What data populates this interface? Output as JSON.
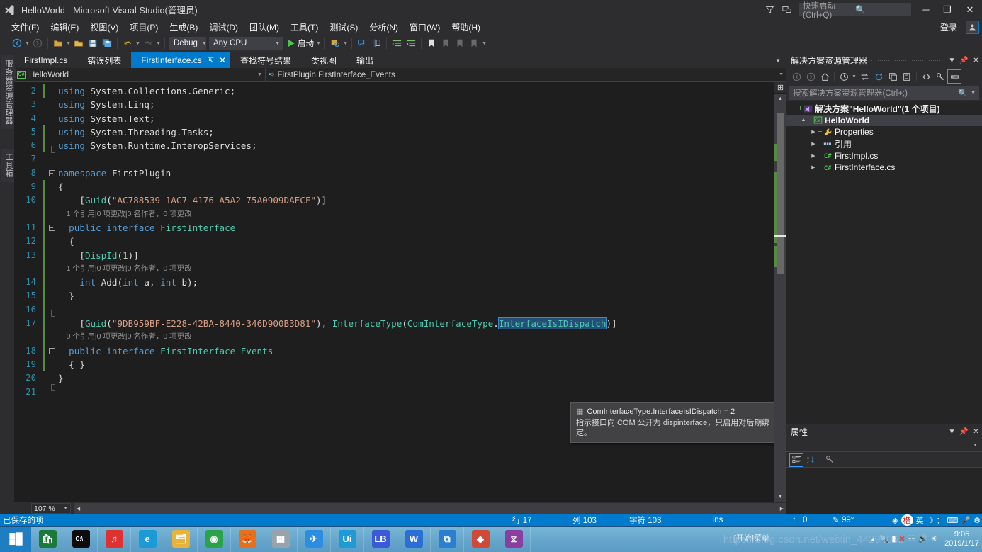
{
  "titlebar": {
    "app_title": "HelloWorld - Microsoft Visual Studio(管理员)",
    "quick_launch_placeholder": "快速启动 (Ctrl+Q)",
    "icons": {
      "feedback": "funnel-icon",
      "layout": "window-layout-icon",
      "search": "search-icon"
    },
    "minimize": "─",
    "restore": "❐",
    "close": "✕"
  },
  "menubar": {
    "items": [
      {
        "label": "文件(F)"
      },
      {
        "label": "编辑(E)"
      },
      {
        "label": "视图(V)"
      },
      {
        "label": "项目(P)"
      },
      {
        "label": "生成(B)"
      },
      {
        "label": "调试(D)"
      },
      {
        "label": "团队(M)"
      },
      {
        "label": "工具(T)"
      },
      {
        "label": "测试(S)"
      },
      {
        "label": "分析(N)"
      },
      {
        "label": "窗口(W)"
      },
      {
        "label": "帮助(H)"
      }
    ],
    "signin_label": "登录"
  },
  "toolbar": {
    "config": "Debug",
    "platform": "Any CPU",
    "run_label": "启动"
  },
  "tabs": {
    "items": [
      {
        "label": "FirstImpl.cs",
        "active": false
      },
      {
        "label": "错误列表",
        "active": false
      },
      {
        "label": "FirstInterface.cs",
        "active": true
      },
      {
        "label": "查找符号结果",
        "active": false
      },
      {
        "label": "类视图",
        "active": false
      },
      {
        "label": "输出",
        "active": false
      }
    ],
    "pin_glyph": "⇱",
    "close_glyph": "✕"
  },
  "navbar": {
    "project": "HelloWorld",
    "member": "FirstPlugin.FirstInterface_Events"
  },
  "editor": {
    "zoom": "107 %",
    "lines": [
      {
        "num": "2",
        "codelens": null,
        "change": true,
        "fold": null,
        "guide": "none",
        "tokens": [
          {
            "t": "using ",
            "c": "k-blue"
          },
          {
            "t": "System.Collections.Generic;",
            "c": "k-plain"
          }
        ],
        "indent": 0
      },
      {
        "num": "3",
        "codelens": null,
        "change": false,
        "fold": null,
        "guide": "line",
        "tokens": [
          {
            "t": "using ",
            "c": "k-blue"
          },
          {
            "t": "System.Linq;",
            "c": "k-plain"
          }
        ],
        "indent": 0
      },
      {
        "num": "4",
        "codelens": null,
        "change": false,
        "fold": null,
        "guide": "line",
        "tokens": [
          {
            "t": "using ",
            "c": "k-blue"
          },
          {
            "t": "System.Text;",
            "c": "k-plain"
          }
        ],
        "indent": 0
      },
      {
        "num": "5",
        "codelens": null,
        "change": true,
        "fold": null,
        "guide": "line",
        "tokens": [
          {
            "t": "using ",
            "c": "k-blue"
          },
          {
            "t": "System.Threading.Tasks;",
            "c": "k-plain"
          }
        ],
        "indent": 0
      },
      {
        "num": "6",
        "codelens": null,
        "change": true,
        "fold": null,
        "guide": "endline",
        "tokens": [
          {
            "t": "using ",
            "c": "k-blue"
          },
          {
            "t": "System.Runtime.InteropServices;",
            "c": "k-plain"
          }
        ],
        "indent": 0
      },
      {
        "num": "7",
        "codelens": null,
        "change": false,
        "fold": null,
        "guide": "none",
        "tokens": [],
        "indent": 0
      },
      {
        "num": "8",
        "codelens": null,
        "change": false,
        "fold": "minus",
        "guide": "none",
        "tokens": [
          {
            "t": "namespace ",
            "c": "k-blue"
          },
          {
            "t": "FirstPlugin",
            "c": "k-plain"
          }
        ],
        "indent": 0
      },
      {
        "num": "9",
        "codelens": null,
        "change": true,
        "fold": null,
        "guide": "line",
        "tokens": [
          {
            "t": "{",
            "c": "k-plain"
          }
        ],
        "indent": 0
      },
      {
        "num": "10",
        "codelens": "1 个引用|0 项更改|0 名作者，0 项更改",
        "change": true,
        "fold": null,
        "guide": "line",
        "tokens": [
          {
            "t": "[",
            "c": "k-plain"
          },
          {
            "t": "Guid",
            "c": "k-type"
          },
          {
            "t": "(",
            "c": "k-plain"
          },
          {
            "t": "\"AC788539-1AC7-4176-A5A2-75A0909DAECF\"",
            "c": "k-str"
          },
          {
            "t": ")]",
            "c": "k-plain"
          }
        ],
        "indent": 2
      },
      {
        "num": "11",
        "codelens": null,
        "change": true,
        "fold": "minus",
        "guide": "line",
        "tokens": [
          {
            "t": "public ",
            "c": "k-blue"
          },
          {
            "t": "interface ",
            "c": "k-blue"
          },
          {
            "t": "FirstInterface",
            "c": "k-type"
          }
        ],
        "indent": 1
      },
      {
        "num": "12",
        "codelens": null,
        "change": true,
        "fold": null,
        "guide": "line",
        "tokens": [
          {
            "t": "{",
            "c": "k-plain"
          }
        ],
        "indent": 1
      },
      {
        "num": "13",
        "codelens": "1 个引用|0 项更改|0 名作者，0 项更改",
        "change": true,
        "fold": null,
        "guide": "line",
        "tokens": [
          {
            "t": "[",
            "c": "k-plain"
          },
          {
            "t": "DispId",
            "c": "k-type"
          },
          {
            "t": "(",
            "c": "k-plain"
          },
          {
            "t": "1",
            "c": "k-num"
          },
          {
            "t": ")]",
            "c": "k-plain"
          }
        ],
        "indent": 2
      },
      {
        "num": "14",
        "codelens": null,
        "change": true,
        "fold": null,
        "guide": "line",
        "tokens": [
          {
            "t": "int ",
            "c": "k-blue"
          },
          {
            "t": "Add",
            "c": "k-plain"
          },
          {
            "t": "(",
            "c": "k-plain"
          },
          {
            "t": "int ",
            "c": "k-blue"
          },
          {
            "t": "a, ",
            "c": "k-plain"
          },
          {
            "t": "int ",
            "c": "k-blue"
          },
          {
            "t": "b);",
            "c": "k-plain"
          }
        ],
        "indent": 2
      },
      {
        "num": "15",
        "codelens": null,
        "change": true,
        "fold": null,
        "guide": "line",
        "tokens": [
          {
            "t": "}",
            "c": "k-plain"
          }
        ],
        "indent": 1
      },
      {
        "num": "16",
        "codelens": null,
        "change": true,
        "fold": null,
        "guide": "endline",
        "tokens": [],
        "indent": 0
      },
      {
        "num": "17",
        "codelens": "0 个引用|0 项更改|0 名作者，0 项更改",
        "change": true,
        "fold": null,
        "guide": "line",
        "tokens": [
          {
            "t": "[",
            "c": "k-plain"
          },
          {
            "t": "Guid",
            "c": "k-type"
          },
          {
            "t": "(",
            "c": "k-plain"
          },
          {
            "t": "\"9DB959BF-E228-42BA-8440-346D900B3D81\"",
            "c": "k-str"
          },
          {
            "t": "), ",
            "c": "k-plain"
          },
          {
            "t": "InterfaceType",
            "c": "k-type"
          },
          {
            "t": "(",
            "c": "k-plain"
          },
          {
            "t": "ComInterfaceType",
            "c": "k-type"
          },
          {
            "t": ".",
            "c": "k-plain"
          },
          {
            "t": "InterfaceIsIDispatch",
            "c": "sel k-type"
          },
          {
            "t": ")]",
            "c": "k-plain"
          }
        ],
        "indent": 2
      },
      {
        "num": "18",
        "codelens": null,
        "change": true,
        "fold": "minus",
        "guide": "line",
        "tokens": [
          {
            "t": "public ",
            "c": "k-blue"
          },
          {
            "t": "interface ",
            "c": "k-blue"
          },
          {
            "t": "FirstInterface_Events",
            "c": "k-type"
          }
        ],
        "indent": 1
      },
      {
        "num": "19",
        "codelens": null,
        "change": true,
        "fold": null,
        "guide": "line",
        "tokens": [
          {
            "t": "{ }",
            "c": "k-plain"
          }
        ],
        "indent": 1
      },
      {
        "num": "20",
        "codelens": null,
        "change": false,
        "fold": null,
        "guide": "endtop",
        "tokens": [
          {
            "t": "}",
            "c": "k-plain"
          }
        ],
        "indent": 0
      },
      {
        "num": "21",
        "codelens": null,
        "change": false,
        "fold": null,
        "guide": "none",
        "tokens": [],
        "indent": 0
      }
    ]
  },
  "tooltip": {
    "signature": "ComInterfaceType.InterfaceIsIDispatch = 2",
    "description": "指示接口向 COM 公开为 dispinterface，只启用对后期绑定。",
    "icon": "enum-member-icon"
  },
  "solution_explorer": {
    "title": "解决方案资源管理器",
    "search_placeholder": "搜索解决方案资源管理器(Ctrl+;)",
    "tree": [
      {
        "label": "解决方案\"HelloWorld\"(1 个项目)",
        "depth": 0,
        "icon": "solution-icon",
        "plus": true,
        "expander": "",
        "bold": true,
        "selected": false
      },
      {
        "label": "HelloWorld",
        "depth": 1,
        "icon": "csharp-project-icon",
        "plus": false,
        "expander": "▲",
        "bold": true,
        "selected": true
      },
      {
        "label": "Properties",
        "depth": 2,
        "icon": "wrench-icon",
        "plus": true,
        "expander": "▶",
        "bold": false,
        "selected": false
      },
      {
        "label": "引用",
        "depth": 2,
        "icon": "references-icon",
        "plus": false,
        "expander": "▶",
        "bold": false,
        "selected": false
      },
      {
        "label": "FirstImpl.cs",
        "depth": 2,
        "icon": "csharp-file-icon",
        "plus": false,
        "expander": "▶",
        "bold": false,
        "selected": false
      },
      {
        "label": "FirstInterface.cs",
        "depth": 2,
        "icon": "csharp-file-icon",
        "plus": true,
        "expander": "▶",
        "bold": false,
        "selected": false
      }
    ]
  },
  "properties_panel": {
    "title": "属性"
  },
  "left_dock": {
    "tabs": [
      {
        "label": "服务器资源管理器"
      },
      {
        "label": "工具箱"
      }
    ]
  },
  "status_bar": {
    "message": "已保存的项",
    "line": "行 17",
    "column": "列 103",
    "chars": "字符 103",
    "insert_mode": "Ins",
    "up_count": "0",
    "pct": "99°"
  },
  "taskbar": {
    "start": "start-icon",
    "items": [
      {
        "name": "microsoft-store-icon",
        "glyph": "🛍",
        "color": "#1a7a3c"
      },
      {
        "name": "command-prompt-icon",
        "glyph": "C:\\_",
        "color": "#0c0c0c"
      },
      {
        "name": "netease-music-icon",
        "glyph": "♫",
        "color": "#e03131"
      },
      {
        "name": "internet-explorer-icon",
        "glyph": "e",
        "color": "#1a9ad7"
      },
      {
        "name": "file-explorer-icon",
        "glyph": "🗂",
        "color": "#e8b33a"
      },
      {
        "name": "chrome-icon",
        "glyph": "◉",
        "color": "#2aa34a"
      },
      {
        "name": "firefox-icon",
        "glyph": "🦊",
        "color": "#e8701a"
      },
      {
        "name": "process-monitor-icon",
        "glyph": "▦",
        "color": "#9aa2ab"
      },
      {
        "name": "foxmail-icon",
        "glyph": "✈",
        "color": "#2b8ee0"
      },
      {
        "name": "uipath-icon",
        "glyph": "Ui",
        "color": "#1e9ad6"
      },
      {
        "name": "lanzou-icon",
        "glyph": "LB",
        "color": "#3b5ad6"
      },
      {
        "name": "wps-icon",
        "glyph": "W",
        "color": "#2b6fd6"
      },
      {
        "name": "vscode-icon",
        "glyph": "⧉",
        "color": "#2b7fd0"
      },
      {
        "name": "sourcetree-icon",
        "glyph": "◆",
        "color": "#d04a3a"
      },
      {
        "name": "visual-studio-icon",
        "glyph": "⧖",
        "color": "#8a3fa0"
      }
    ],
    "start_menu_hint": "[开始]菜单",
    "watermark": "https://blog.csdn.net/weixin_44294062",
    "clock_time": "9:05",
    "clock_date": "2019/1/17"
  }
}
